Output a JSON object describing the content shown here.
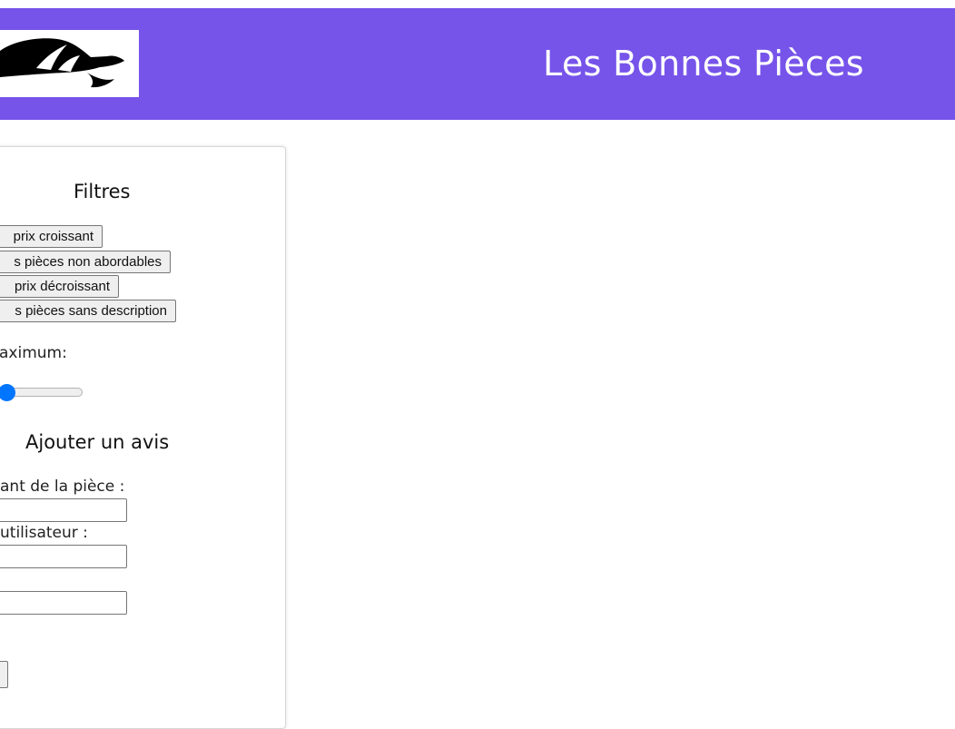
{
  "header": {
    "title": "Les Bonnes Pièces",
    "logo_icon": "car-logo-icon",
    "background_color": "#7654ea"
  },
  "filters": {
    "heading": "Filtres",
    "buttons": [
      "prix croissant",
      "s pièces non abordables",
      "prix décroissant",
      "s pièces sans description"
    ],
    "price_label": "aximum:",
    "price_slider": {
      "level_fraction": 0.13,
      "accent_color": "#0075ff"
    }
  },
  "review": {
    "heading": "Ajouter un avis",
    "fields": [
      {
        "label": "ant de la pièce :",
        "value": ""
      },
      {
        "label": "utilisateur :",
        "value": ""
      },
      {
        "label": "",
        "value": ""
      }
    ]
  }
}
